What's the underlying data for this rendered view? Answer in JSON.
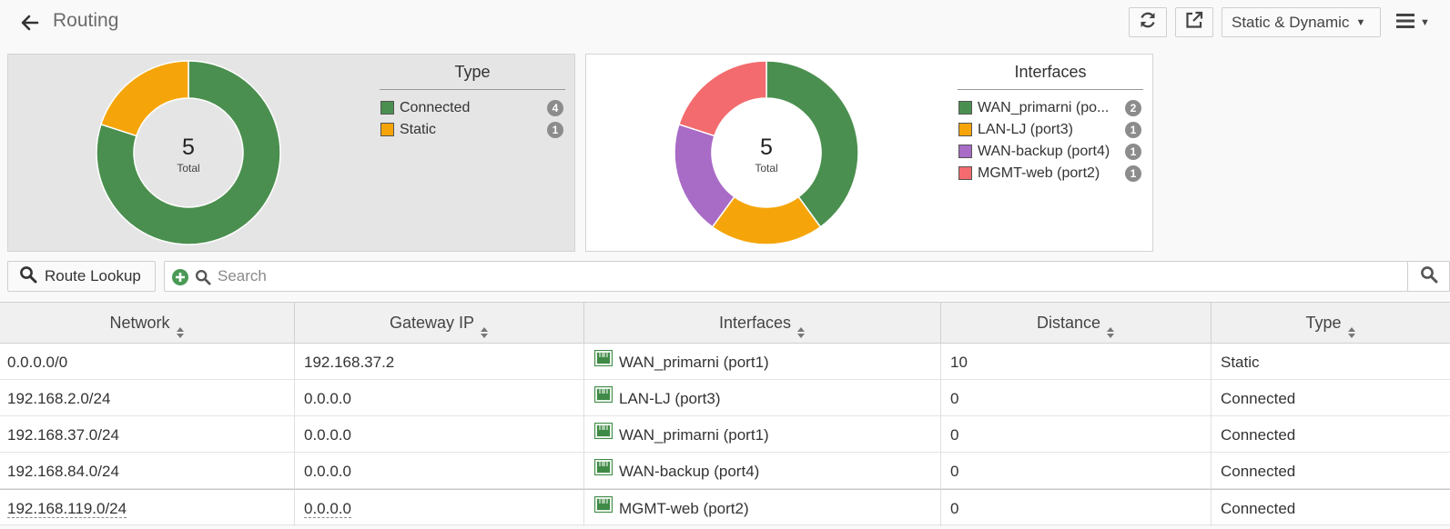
{
  "header": {
    "title": "Routing",
    "view_select": "Static & Dynamic"
  },
  "colors": {
    "connected": "#4a8f4f",
    "static": "#f5a50a",
    "wan_primarni": "#4a8f4f",
    "lan_lj": "#f5a50a",
    "wan_backup": "#a86bc6",
    "mgmt_web": "#f36b6e"
  },
  "widgets": [
    {
      "legend_title": "Type",
      "total_value": "5",
      "total_label": "Total",
      "items": [
        {
          "label": "Connected",
          "count": "4",
          "color": "#4a8f4f"
        },
        {
          "label": "Static",
          "count": "1",
          "color": "#f5a50a"
        }
      ]
    },
    {
      "legend_title": "Interfaces",
      "total_value": "5",
      "total_label": "Total",
      "items": [
        {
          "label": "WAN_primarni (po...",
          "count": "2",
          "color": "#4a8f4f"
        },
        {
          "label": "LAN-LJ (port3)",
          "count": "1",
          "color": "#f5a50a"
        },
        {
          "label": "WAN-backup (port4)",
          "count": "1",
          "color": "#a86bc6"
        },
        {
          "label": "MGMT-web (port2)",
          "count": "1",
          "color": "#f36b6e"
        }
      ]
    }
  ],
  "toolbar": {
    "route_lookup_label": "Route Lookup",
    "search_placeholder": "Search"
  },
  "table": {
    "columns": [
      "Network",
      "Gateway IP",
      "Interfaces",
      "Distance",
      "Type"
    ],
    "rows": [
      {
        "network": "0.0.0.0/0",
        "gateway": "192.168.37.2",
        "interface": "WAN_primarni (port1)",
        "distance": "10",
        "type": "Static"
      },
      {
        "network": "192.168.2.0/24",
        "gateway": "0.0.0.0",
        "interface": "LAN-LJ (port3)",
        "distance": "0",
        "type": "Connected"
      },
      {
        "network": "192.168.37.0/24",
        "gateway": "0.0.0.0",
        "interface": "WAN_primarni (port1)",
        "distance": "0",
        "type": "Connected"
      },
      {
        "network": "192.168.84.0/24",
        "gateway": "0.0.0.0",
        "interface": "WAN-backup (port4)",
        "distance": "0",
        "type": "Connected"
      },
      {
        "network": "192.168.119.0/24",
        "gateway": "0.0.0.0",
        "interface": "MGMT-web (port2)",
        "distance": "0",
        "type": "Connected"
      }
    ]
  }
}
